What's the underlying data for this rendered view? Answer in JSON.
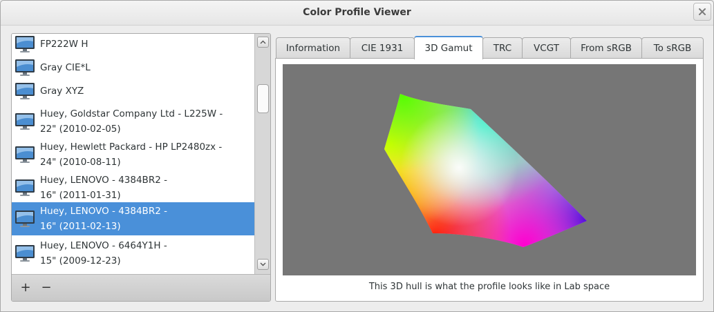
{
  "window": {
    "title": "Color Profile Viewer"
  },
  "profiles": [
    {
      "line1": "FP222W H",
      "line2": ""
    },
    {
      "line1": "Gray CIE*L",
      "line2": ""
    },
    {
      "line1": "Gray XYZ",
      "line2": ""
    },
    {
      "line1": "Huey, Goldstar Company Ltd - L225W -",
      "line2": "22\" (2010-02-05)"
    },
    {
      "line1": "Huey, Hewlett Packard - HP LP2480zx -",
      "line2": "24\" (2010-08-11)"
    },
    {
      "line1": "Huey, LENOVO - 4384BR2 -",
      "line2": "16\" (2011-01-31)"
    },
    {
      "line1": "Huey, LENOVO - 4384BR2 -",
      "line2": "16\" (2011-02-13)",
      "selected": true
    },
    {
      "line1": "Huey, LENOVO - 6464Y1H -",
      "line2": "15\" (2009-12-23)"
    }
  ],
  "toolbar": {
    "add_label": "+",
    "remove_label": "−"
  },
  "tabs": [
    {
      "label": "Information"
    },
    {
      "label": "CIE 1931"
    },
    {
      "label": "3D Gamut",
      "active": true
    },
    {
      "label": "TRC"
    },
    {
      "label": "VCGT"
    },
    {
      "label": "From sRGB"
    },
    {
      "label": "To sRGB"
    }
  ],
  "gamut_view": {
    "caption": "This 3D hull is what the profile looks like in Lab space",
    "background": "#767676"
  },
  "colors": {
    "accent": "#4a90d9"
  },
  "icons": {
    "close": "close-icon",
    "profile": "display-icon",
    "up": "chevron-up-icon",
    "down": "chevron-down-icon"
  }
}
